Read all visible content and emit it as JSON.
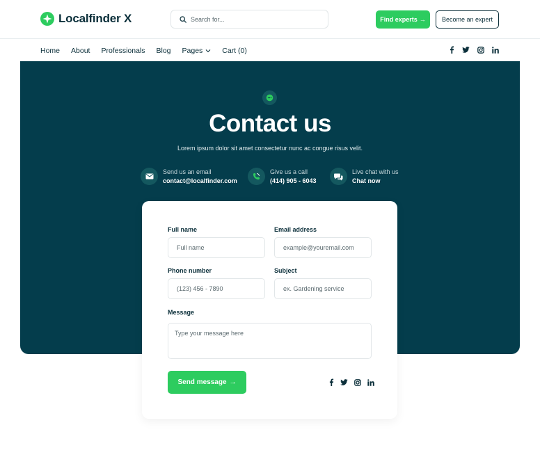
{
  "brand": {
    "name": "Localfinder X"
  },
  "search": {
    "placeholder": "Search for..."
  },
  "header": {
    "find_experts": "Find experts",
    "become_expert": "Become an expert"
  },
  "nav": {
    "items": [
      "Home",
      "About",
      "Professionals",
      "Blog",
      "Pages",
      "Cart (0)"
    ]
  },
  "social": [
    "facebook-icon",
    "twitter-icon",
    "instagram-icon",
    "linkedin-icon"
  ],
  "hero": {
    "title": "Contact us",
    "subtitle": "Lorem ipsum dolor sit amet consectetur nunc ac congue risus velit.",
    "contacts": [
      {
        "label": "Send us an email",
        "value": "contact@localfinder.com",
        "icon": "mail-icon"
      },
      {
        "label": "Give us a call",
        "value": "(414) 905 - 6043",
        "icon": "phone-icon"
      },
      {
        "label": "Live chat with us",
        "value": "Chat now",
        "icon": "chat-icon"
      }
    ]
  },
  "form": {
    "full_name": {
      "label": "Full name",
      "placeholder": "Full name"
    },
    "email": {
      "label": "Email address",
      "placeholder": "example@youremail.com"
    },
    "phone": {
      "label": "Phone number",
      "placeholder": "(123) 456 - 7890"
    },
    "subject": {
      "label": "Subject",
      "placeholder": "ex. Gardening service"
    },
    "message": {
      "label": "Message",
      "placeholder": "Type your message here"
    },
    "submit": "Send message"
  },
  "colors": {
    "primary_dark": "#043d4c",
    "accent_green": "#2dcc5f",
    "text_dark": "#0b2f3a"
  }
}
